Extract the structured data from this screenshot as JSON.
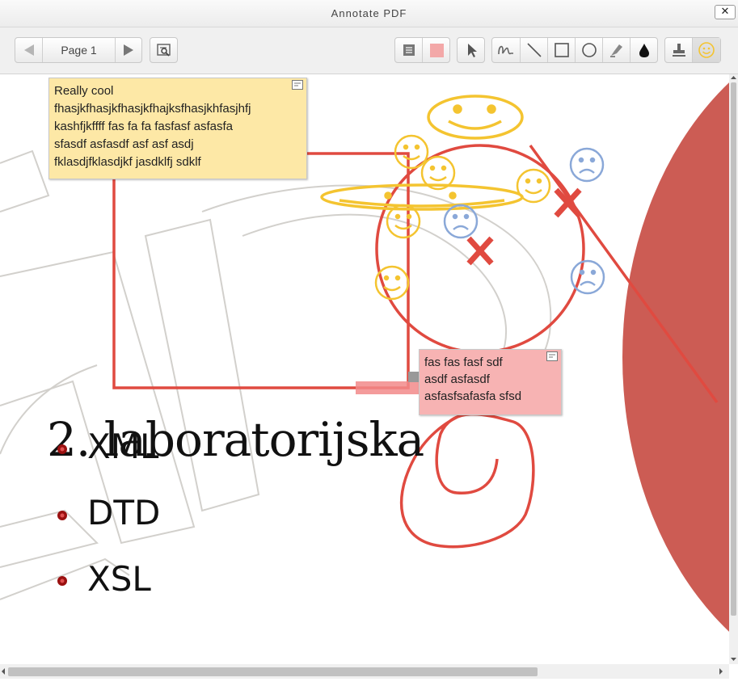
{
  "window": {
    "title": "Annotate PDF",
    "close_label": "✕"
  },
  "toolbar": {
    "prev_page": "previous-page",
    "page_label": "Page 1",
    "next_page": "next-page",
    "search_comments": "search-comments",
    "tools": [
      "comment",
      "color-picker",
      "select",
      "pen",
      "line",
      "rectangle",
      "oval",
      "highlighter",
      "ink-color",
      "stamp",
      "smiley"
    ],
    "comment_color": "#f3a8a8",
    "active_tool": "smiley"
  },
  "notes": {
    "yellow": {
      "lines": [
        "Really cool",
        "fhasjkfhasjkfhasjkfhajksfhasjkhfasjhfj",
        "kashfjkffff fas fa fa fasfasf asfasfa",
        "sfasdf asfasdf asf asf asdj",
        "fklasdjfklasdjkf jasdklfj sdklf"
      ],
      "color": "#fde8a6"
    },
    "pink": {
      "lines": [
        "fas fas fasf sdf",
        "asdf  asfasdf",
        "asfasfsafasfa sfsd"
      ],
      "color": "#f7b3b3"
    }
  },
  "slide": {
    "title": "2. laboratorijska",
    "bullets": [
      "XML",
      "DTD",
      "XSL"
    ],
    "accent_color": "#cc5c54"
  },
  "annotations": {
    "stroke_color": "#e04a40",
    "smiley_color": "#f4c430",
    "frown_color": "#8aa8d8"
  }
}
